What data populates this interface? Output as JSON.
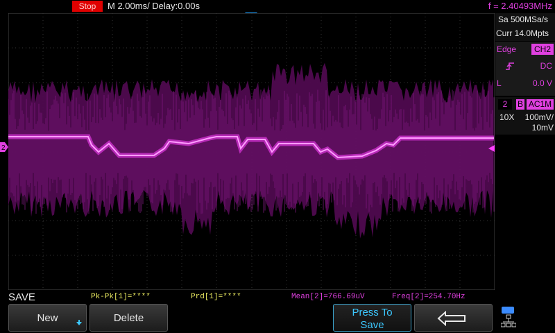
{
  "top_bar": {
    "run_state": "Stop",
    "timebase": "M 2.00ms/ Delay:0.00s",
    "frequency": "f = 2.40493MHz"
  },
  "right_panel": {
    "sample_rate": "Sa 500MSa/s",
    "memory_depth": "Curr 14.0Mpts",
    "trigger": {
      "type": "Edge",
      "source": "CH2",
      "slope_icon": "rising-edge-icon",
      "coupling": "DC",
      "level_label": "L",
      "level": "0.0 V"
    },
    "channel": {
      "number": "2",
      "bw_flag": "B",
      "coupling": "AC1M",
      "probe": "10X",
      "scale": "100mV/",
      "offset": "10mV"
    }
  },
  "menu_title": "SAVE",
  "measurements": {
    "pkpk": "Pk-Pk[1]=****",
    "prd": "Prd[1]=****",
    "mean": "Mean[2]=766.69uV",
    "freq": "Freq[2]=254.70Hz"
  },
  "softkeys": {
    "new": "New",
    "delete": "Delete",
    "press_to_save_line1": "Press To",
    "press_to_save_line2": "Save",
    "back_icon": "return-arrow-icon",
    "network_icon": "network-icon"
  },
  "colors": {
    "trace": "#ff40ff",
    "trace_envelope": "#5a0a5a",
    "grid": "#3a3a3a",
    "stop_bg": "#e00000",
    "trigger_marker": "#20a0ff",
    "accent_cyan": "#3cc8ff"
  },
  "channel_marker": "2"
}
